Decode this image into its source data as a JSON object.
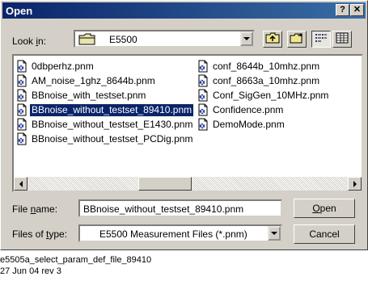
{
  "window": {
    "title": "Open",
    "help_label": "?",
    "close_label": "✕"
  },
  "look_in": {
    "label_pre": "Look ",
    "label_ul": "i",
    "label_post": "n:",
    "value": "E5500",
    "icon": "folder-icon"
  },
  "toolbar": {
    "up_icon": "up-one-level-icon",
    "new_folder_icon": "new-folder-icon",
    "list_icon": "list-view-icon",
    "details_icon": "details-view-icon"
  },
  "files": {
    "column1": [
      {
        "name": "0dbperhz.pnm",
        "selected": false
      },
      {
        "name": "AM_noise_1ghz_8644b.pnm",
        "selected": false
      },
      {
        "name": "BBnoise_with_testset.pnm",
        "selected": false
      },
      {
        "name": "BBnoise_without_testset_89410.pnm",
        "selected": true
      },
      {
        "name": "BBnoise_without_testset_E1430.pnm",
        "selected": false
      },
      {
        "name": "BBnoise_without_testset_PCDig.pnm",
        "selected": false
      }
    ],
    "column2": [
      {
        "name": "conf_8644b_10mhz.pnm",
        "selected": false
      },
      {
        "name": "conf_8663a_10mhz.pnm",
        "selected": false
      },
      {
        "name": "Conf_SigGen_10MHz.pnm",
        "selected": false
      },
      {
        "name": "Confidence.pnm",
        "selected": false
      },
      {
        "name": "DemoMode.pnm",
        "selected": false
      }
    ]
  },
  "file_name": {
    "label_pre": "File ",
    "label_ul": "n",
    "label_post": "ame:",
    "value": "BBnoise_without_testset_89410.pnm"
  },
  "file_type": {
    "label_pre": "Files of ",
    "label_ul": "t",
    "label_post": "ype:",
    "value": "E5500 Measurement Files (*.pnm)"
  },
  "buttons": {
    "open_ul": "O",
    "open_rest": "pen",
    "cancel": "Cancel"
  },
  "caption": {
    "line1": "e5505a_select_param_def_file_89410",
    "line2": "27 Jun 04  rev 3"
  },
  "colors": {
    "titlebar": "#0a246a",
    "selection": "#0a246a",
    "face": "#d4d0c8"
  }
}
